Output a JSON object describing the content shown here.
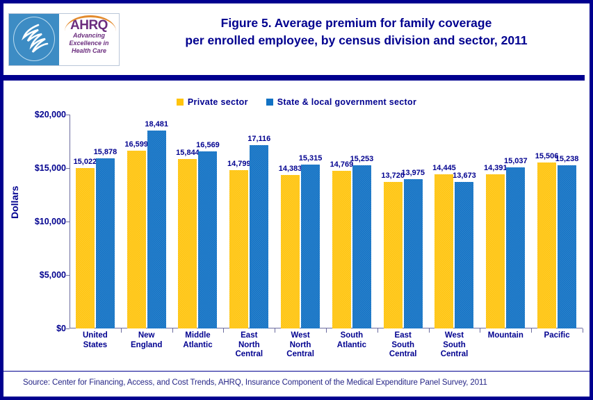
{
  "header": {
    "title_line1": "Figure 5. Average premium for family coverage",
    "title_line2": "per enrolled employee, by census division and sector, 2011",
    "logo": {
      "agency_acronym": "AHRQ",
      "tagline_line1": "Advancing",
      "tagline_line2": "Excellence in",
      "tagline_line3": "Health Care",
      "seal_name": "hhs-seal"
    }
  },
  "footer": {
    "source": "Source: Center for Financing, Access, and Cost Trends, AHRQ, Insurance Component of the Medical Expenditure Panel Survey,  2011"
  },
  "colors": {
    "private": "#FFC40D",
    "government": "#1272C4",
    "text_navy": "#00008F",
    "border_navy": "#00008F"
  },
  "chart_data": {
    "type": "bar",
    "title": "Figure 5. Average premium for family coverage per enrolled employee, by census division and sector, 2011",
    "xlabel": "",
    "ylabel": "Dollars",
    "ylim": [
      0,
      20000
    ],
    "yticks": [
      0,
      5000,
      10000,
      15000,
      20000
    ],
    "ytick_labels": [
      "$0",
      "$5,000",
      "$10,000",
      "$15,000",
      "$20,000"
    ],
    "grid": false,
    "legend_position": "top-center",
    "categories": [
      "United\nStates",
      "New\nEngland",
      "Middle\nAtlantic",
      "East\nNorth\nCentral",
      "West\nNorth\nCentral",
      "South\nAtlantic",
      "East\nSouth\nCentral",
      "West\nSouth\nCentral",
      "Mountain",
      "Pacific"
    ],
    "series": [
      {
        "name": "Private sector",
        "color": "#FFC40D",
        "values": [
          15022,
          16599,
          15844,
          14799,
          14383,
          14769,
          13720,
          14445,
          14391,
          15506
        ],
        "labels": [
          "15,022",
          "16,599",
          "15,844",
          "14,799",
          "14,383",
          "14,769",
          "13,720",
          "14,445",
          "14,391",
          "15,506"
        ]
      },
      {
        "name": "State & local government sector",
        "color": "#1272C4",
        "values": [
          15878,
          18481,
          16569,
          17116,
          15315,
          15253,
          13975,
          13673,
          15037,
          15238
        ],
        "labels": [
          "15,878",
          "18,481",
          "16,569",
          "17,116",
          "15,315",
          "15,253",
          "13,975",
          "13,673",
          "15,037",
          "15,238"
        ]
      }
    ]
  }
}
